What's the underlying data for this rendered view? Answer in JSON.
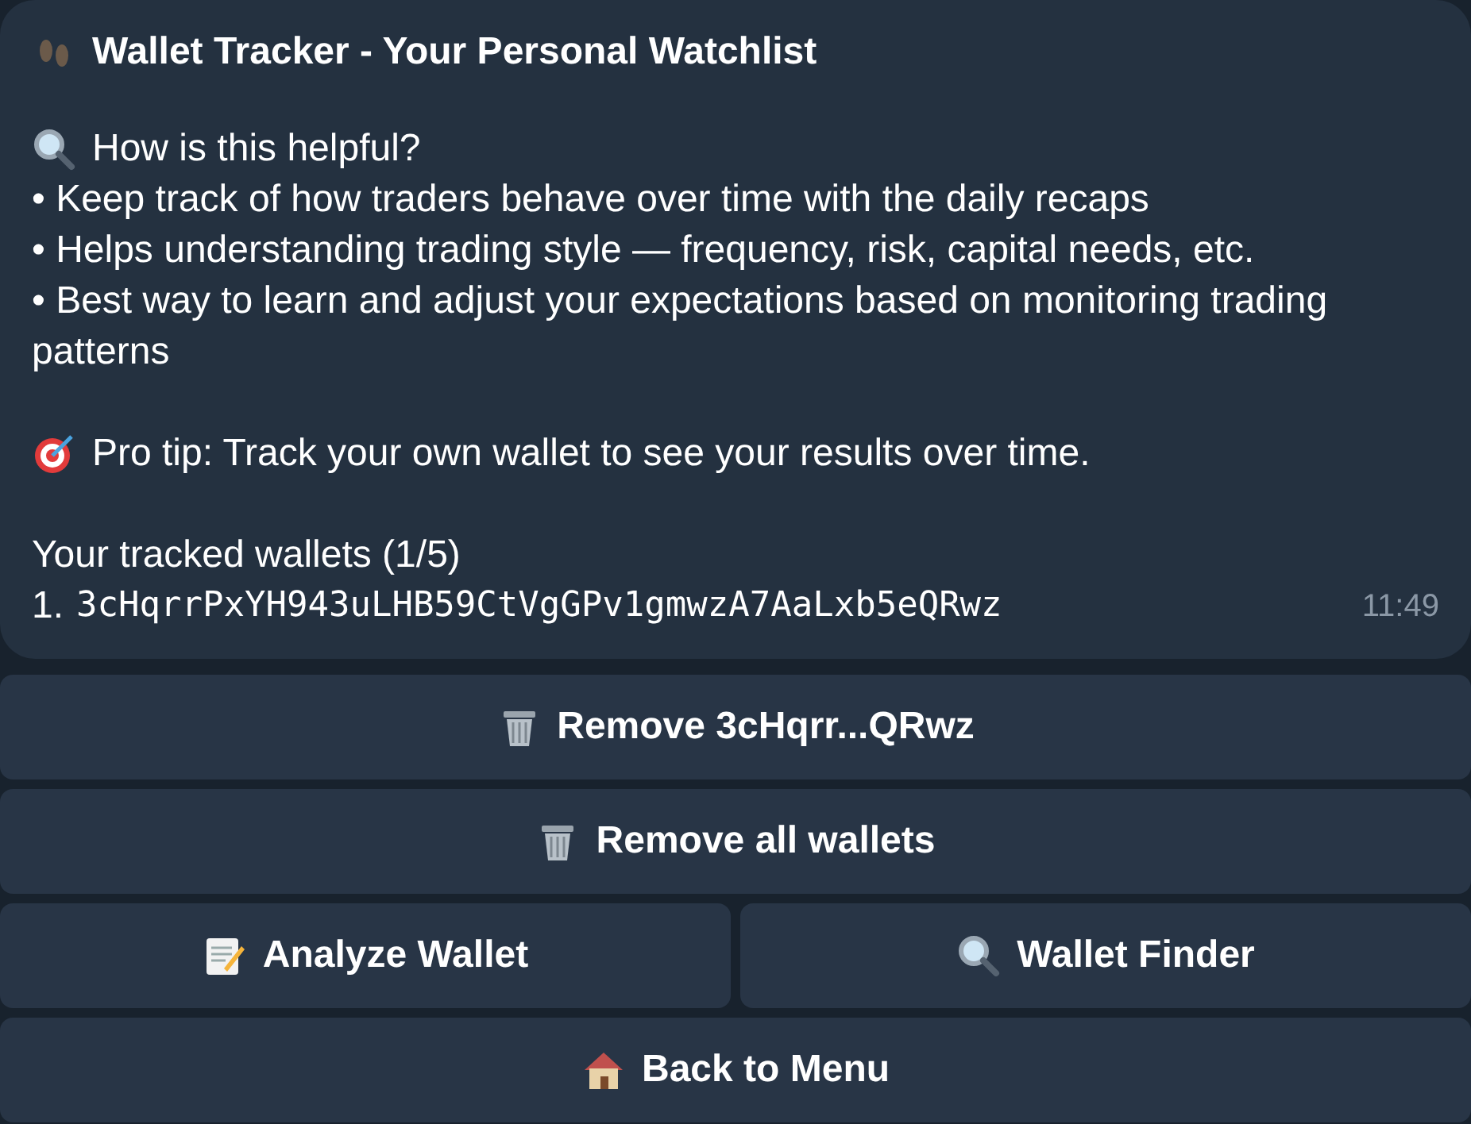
{
  "message": {
    "title": "Wallet Tracker - Your Personal Watchlist",
    "section_heading": "How is this helpful?",
    "bullets": [
      "• Keep track of how traders behave over time with the daily recaps",
      "• Helps understanding trading style — frequency, risk, capital needs, etc.",
      "• Best way to learn and adjust your expectations based on monitoring trading patterns"
    ],
    "tip": "Pro tip: Track your own wallet to see your results over time.",
    "wallets_heading": "Your tracked wallets (1/5)",
    "wallets": [
      {
        "index": "1.",
        "address": "3cHqrrPxYH943uLHB59CtVgGPv1gmwzA7AaLxb5eQRwz"
      }
    ],
    "time": "11:49"
  },
  "buttons": [
    [
      {
        "label": "Remove 3cHqrr...QRwz",
        "kind": "trash"
      }
    ],
    [
      {
        "label": "Remove all wallets",
        "kind": "trash"
      }
    ],
    [
      {
        "label": "Analyze Wallet",
        "kind": "memo"
      },
      {
        "label": "Wallet Finder",
        "kind": "search"
      }
    ],
    [
      {
        "label": "Back to Menu",
        "kind": "house"
      }
    ]
  ]
}
